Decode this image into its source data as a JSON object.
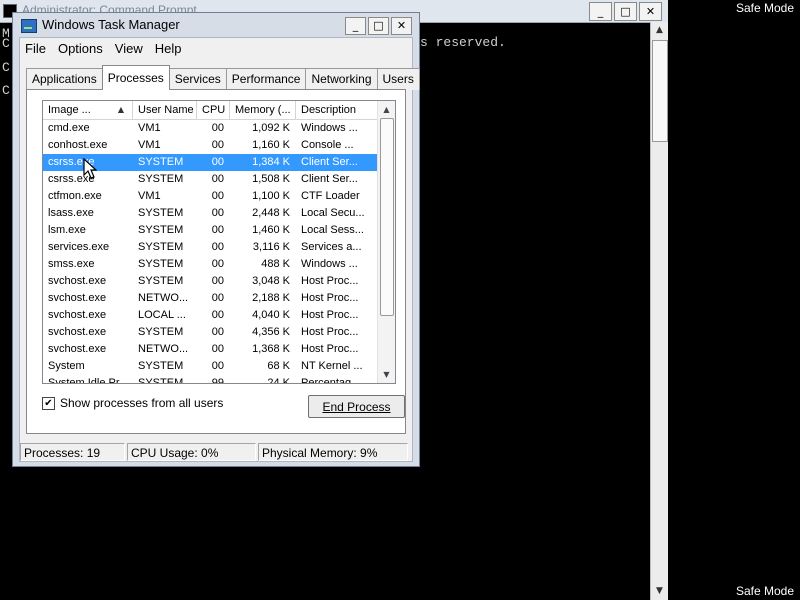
{
  "desktop": {
    "safe_mode_top": "Safe Mode",
    "safe_mode_bottom": "Safe Mode"
  },
  "cmd": {
    "title": "Administrator: Command Prompt",
    "visible_text": "s reserved.",
    "left_chars": [
      "M",
      "C",
      "C",
      "C"
    ]
  },
  "task_manager": {
    "title": "Windows Task Manager",
    "menu": [
      "File",
      "Options",
      "View",
      "Help"
    ],
    "tabs": [
      "Applications",
      "Processes",
      "Services",
      "Performance",
      "Networking",
      "Users"
    ],
    "active_tab": "Processes",
    "columns": [
      "Image ...",
      "User Name",
      "CPU",
      "Memory (...",
      "Description"
    ],
    "rows": [
      {
        "name": "cmd.exe",
        "user": "VM1",
        "cpu": "00",
        "mem": "1,092 K",
        "desc": "Windows ..."
      },
      {
        "name": "conhost.exe",
        "user": "VM1",
        "cpu": "00",
        "mem": "1,160 K",
        "desc": "Console ..."
      },
      {
        "name": "csrss.exe",
        "user": "SYSTEM",
        "cpu": "00",
        "mem": "1,384 K",
        "desc": "Client Ser...",
        "selected": true
      },
      {
        "name": "csrss.exe",
        "user": "SYSTEM",
        "cpu": "00",
        "mem": "1,508 K",
        "desc": "Client Ser..."
      },
      {
        "name": "ctfmon.exe",
        "user": "VM1",
        "cpu": "00",
        "mem": "1,100 K",
        "desc": "CTF Loader"
      },
      {
        "name": "lsass.exe",
        "user": "SYSTEM",
        "cpu": "00",
        "mem": "2,448 K",
        "desc": "Local Secu..."
      },
      {
        "name": "lsm.exe",
        "user": "SYSTEM",
        "cpu": "00",
        "mem": "1,460 K",
        "desc": "Local Sess..."
      },
      {
        "name": "services.exe",
        "user": "SYSTEM",
        "cpu": "00",
        "mem": "3,116 K",
        "desc": "Services a..."
      },
      {
        "name": "smss.exe",
        "user": "SYSTEM",
        "cpu": "00",
        "mem": "488 K",
        "desc": "Windows ..."
      },
      {
        "name": "svchost.exe",
        "user": "SYSTEM",
        "cpu": "00",
        "mem": "3,048 K",
        "desc": "Host Proc..."
      },
      {
        "name": "svchost.exe",
        "user": "NETWO...",
        "cpu": "00",
        "mem": "2,188 K",
        "desc": "Host Proc..."
      },
      {
        "name": "svchost.exe",
        "user": "LOCAL ...",
        "cpu": "00",
        "mem": "4,040 K",
        "desc": "Host Proc..."
      },
      {
        "name": "svchost.exe",
        "user": "SYSTEM",
        "cpu": "00",
        "mem": "4,356 K",
        "desc": "Host Proc..."
      },
      {
        "name": "svchost.exe",
        "user": "NETWO...",
        "cpu": "00",
        "mem": "1,368 K",
        "desc": "Host Proc..."
      },
      {
        "name": "System",
        "user": "SYSTEM",
        "cpu": "00",
        "mem": "68 K",
        "desc": "NT Kernel ..."
      },
      {
        "name": "System Idle Pr...",
        "user": "SYSTEM",
        "cpu": "99",
        "mem": "24 K",
        "desc": "Percentag..."
      }
    ],
    "show_all_label": "Show processes from all users",
    "show_all_checked": true,
    "end_process_label": "End Process",
    "status": {
      "processes": "Processes: 19",
      "cpu": "CPU Usage: 0%",
      "memory": "Physical Memory: 9%"
    },
    "caption_buttons": {
      "minimize": "_",
      "maximize": "□",
      "close": "✕"
    }
  },
  "colors": {
    "selection": "#3399ff",
    "title_bg": "#d6dde7"
  },
  "icons": [
    "cmd-icon",
    "task-manager-icon",
    "sort-arrow-icon",
    "check-icon",
    "cursor-icon"
  ]
}
